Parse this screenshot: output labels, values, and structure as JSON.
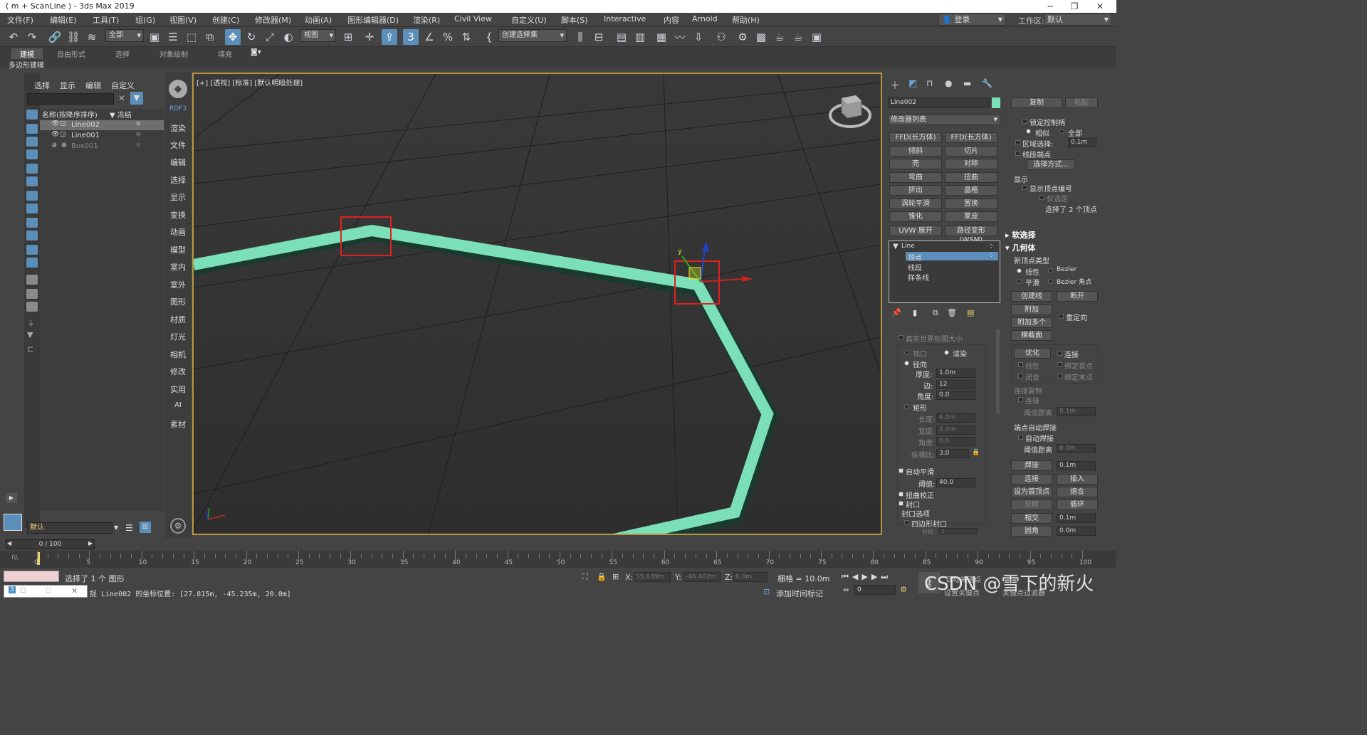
{
  "window": {
    "title": "( m + ScanLine ) - 3ds Max 2019"
  },
  "menubar": {
    "items": [
      "文件(F)",
      "编辑(E)",
      "工具(T)",
      "组(G)",
      "视图(V)",
      "创建(C)",
      "修改器(M)",
      "动画(A)",
      "图形编辑器(D)",
      "渲染(R)",
      "Civil View",
      "自定义(U)",
      "脚本(S)",
      "Interactive",
      "内容",
      "Arnold",
      "帮助(H)"
    ],
    "login": "登录",
    "workspace_label": "工作区:",
    "workspace_value": "默认"
  },
  "toolbar": {
    "filter": "全部",
    "ref_coord": "视图",
    "selection_set": "创建选择集"
  },
  "ribbon": {
    "tabs": [
      "建模",
      "自由形式",
      "选择",
      "对象绘制",
      "填充"
    ],
    "active": "建模",
    "sub": "多边形建模"
  },
  "explorer": {
    "menu": [
      "选择",
      "显示",
      "编辑",
      "自定义"
    ],
    "col_name": "名称(按降序排序)",
    "col_freeze": "▼ 冻结",
    "rows": [
      {
        "name": "Line002",
        "selected": true
      },
      {
        "name": "Line001",
        "selected": false
      },
      {
        "name": "Box001",
        "selected": false
      }
    ],
    "layer": "默认"
  },
  "categories": [
    "RDF3",
    "渲染",
    "文件",
    "编辑",
    "选择",
    "显示",
    "变换",
    "动画",
    "模型",
    "室内",
    "室外",
    "图形",
    "材质",
    "灯光",
    "相机",
    "修改",
    "实用",
    "AI",
    "素材"
  ],
  "viewport": {
    "label": "[+] [透视] [标准] [默认明暗处理]"
  },
  "modify": {
    "object_name": "Line002",
    "object_color": "#7be0b8",
    "modifier_list": "修改器列表",
    "buttons": [
      "FFD(长方体)",
      "FFD(长方体)",
      "倾斜",
      "切片",
      "壳",
      "对称",
      "弯曲",
      "扭曲",
      "挤出",
      "晶格",
      "涡轮平滑",
      "置换",
      "锥化",
      "蒙皮",
      "UVW 展开",
      "路径变形 (WSM)"
    ],
    "stack": {
      "root": "Line",
      "items": [
        "顶点",
        "线段",
        "样条线"
      ],
      "selected": "顶点"
    },
    "rendering": {
      "real_world": "真实世界贴图大小",
      "viewport": "视口",
      "render": "渲染",
      "radial": "径向",
      "thickness_label": "厚度:",
      "thickness": "1.0m",
      "sides_label": "边:",
      "sides": "12",
      "angle_label": "角度:",
      "angle": "0.0",
      "rect": "矩形",
      "length_label": "长度:",
      "length": "6.0m",
      "width_label": "宽度:",
      "width": "2.0m",
      "angle2_label": "角度:",
      "angle2": "0.0",
      "aspect_label": "纵横比:",
      "aspect": "3.0",
      "auto_smooth": "自动平滑",
      "threshold_label": "阈值:",
      "threshold": "40.0",
      "twist": "扭曲校正",
      "cap": "封口",
      "cap_options": "封口选项",
      "quad_cap": "四边形封口",
      "segments_label": "分段:",
      "segments": "1"
    }
  },
  "geometry": {
    "copy": "复制",
    "paste": "粘贴",
    "lock_handles": "锁定控制柄",
    "alike": "相似",
    "all": "全部",
    "area_sel": "区域选择:",
    "area_val": "0.1m",
    "seg_end": "线段端点",
    "sel_by": "选择方式...",
    "display": "显示",
    "show_vert_num": "显示顶点编号",
    "only_sel": "仅选定",
    "sel_count": "选择了 2 个顶点",
    "soft_sel": "软选择",
    "geo": "几何体",
    "new_vert_type": "新顶点类型",
    "linear": "线性",
    "bezier": "Bezier",
    "smooth": "平滑",
    "bezier_corner": "Bezier 角点",
    "create_line": "创建线",
    "break": "断开",
    "attach": "附加",
    "reorient": "重定向",
    "attach_mult": "附加多个",
    "cross_section": "横截面",
    "refine": "优化",
    "connect": "连接",
    "linear2": "线性",
    "bind_first": "绑定首点",
    "closed": "闭合",
    "bind_last": "绑定末点",
    "connect_copy": "连接复制",
    "connect2": "连接",
    "thresh_dist": "阈值距离",
    "thresh_val": "0.1m",
    "end_weld": "端点自动焊接",
    "auto_weld": "自动焊接",
    "thresh_dist2": "阈值距离",
    "thresh_val2": "6.0m",
    "weld": "焊接",
    "weld_val": "0.1m",
    "connect3": "连接",
    "insert": "插入",
    "make_first": "设为首顶点",
    "fuse": "熔合",
    "reverse": "反转",
    "cycle": "循环",
    "cross_insert": "相交",
    "cross_val": "0.1m",
    "fillet": "圆角",
    "fillet_val": "0.0m"
  },
  "timeline": {
    "slider": "0 / 100",
    "ticks": [
      "0",
      "5",
      "10",
      "15",
      "20",
      "25",
      "30",
      "35",
      "40",
      "45",
      "50",
      "55",
      "60",
      "65",
      "70",
      "75",
      "80",
      "85",
      "90",
      "95",
      "100"
    ]
  },
  "status": {
    "selected": "选择了 1 个 图形",
    "coords": "捉 Line002 的坐标位置: [27.815m, -45.235m, 20.0m]",
    "x_label": "X:",
    "x": "55.639m",
    "y_label": "Y:",
    "y": "-46.402m",
    "z_label": "Z:",
    "z": "0.0m",
    "grid": "栅格 = 10.0m",
    "add_time_tag": "添加时间标记",
    "frame": "0",
    "auto_key": "自动关键点",
    "set_key": "设置关键点",
    "key_filters": "关键点过滤器",
    "watermark": "CSDN @雪下的新火"
  }
}
